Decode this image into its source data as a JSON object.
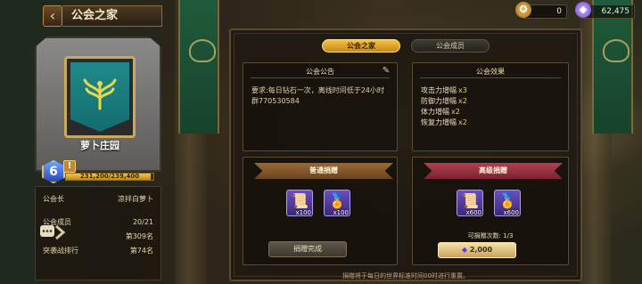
{
  "header": {
    "title": "公会之家",
    "back_icon": "chevron-left-icon",
    "resources": [
      {
        "icon": "medal-icon",
        "value": "0"
      },
      {
        "icon": "diamond-icon",
        "value": "62,475"
      }
    ]
  },
  "guild_card": {
    "name": "萝卜庄园",
    "level": "6",
    "xp_text": "231,200/239,400",
    "xp_fraction": 0.966,
    "leader_label": "公会长",
    "leader_value": "凉拌白萝卜",
    "members_label": "公会成员",
    "members_value": "20/21",
    "rank_value": "第309名",
    "raid_rank_label": "突袭战排行",
    "raid_rank_value": "第74名"
  },
  "tabs": [
    {
      "label": "公会之家",
      "active": true
    },
    {
      "label": "公会成员",
      "active": false
    }
  ],
  "notice": {
    "title": "公会公告",
    "text": "要求:每日钻石一次，离线时间低于24小时",
    "extra": "群770530584"
  },
  "effects": {
    "title": "公会效果",
    "items": [
      {
        "label": "攻击力增幅",
        "multiplier": "x3"
      },
      {
        "label": "防御力增幅",
        "multiplier": "x2"
      },
      {
        "label": "体力增幅",
        "multiplier": "x2"
      },
      {
        "label": "恢复力增幅",
        "multiplier": "x2"
      }
    ]
  },
  "normal_donate": {
    "title": "普通捐赠",
    "items": [
      {
        "icon": "scroll-icon",
        "qty": "x100"
      },
      {
        "icon": "medal-icon",
        "qty": "x100"
      }
    ],
    "done_label": "捐赠完成"
  },
  "advanced_donate": {
    "title": "高级捐赠",
    "items": [
      {
        "icon": "scroll-icon",
        "qty": "x600"
      },
      {
        "icon": "medal-icon",
        "qty": "x600"
      }
    ],
    "count_text": "可捐赠次数: 1/3",
    "cost": "2,000",
    "cost_icon": "diamond-icon"
  },
  "footnote": "捐赠将于每日的世界标准时间00时进行重置。",
  "colors": {
    "accent_gold": "#f6c24a",
    "ribbon_normal": "#9a6a36",
    "ribbon_advanced": "#b04050",
    "banner_teal": "#1f8a8a"
  }
}
